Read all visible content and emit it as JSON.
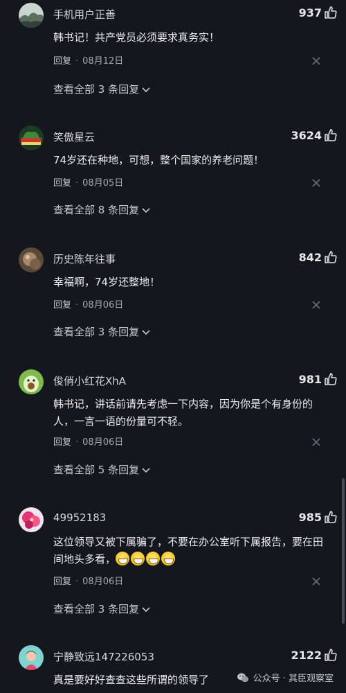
{
  "meta_labels": {
    "reply": "回复",
    "dot": "·"
  },
  "comments": [
    {
      "username": "手机用户正善",
      "likes": "937",
      "content": "韩书记！共产党员必须要求真务实！",
      "date": "08月12日",
      "view_replies": "查看全部 3 条回复"
    },
    {
      "username": "笑傲星云",
      "likes": "3624",
      "content": "74岁还在种地，可想，整个国家的养老问题！",
      "date": "08月05日",
      "view_replies": "查看全部 8 条回复"
    },
    {
      "username": "历史陈年往事",
      "likes": "842",
      "content": "幸福啊，74岁还整地！",
      "date": "08月06日",
      "view_replies": "查看全部 3 条回复"
    },
    {
      "username": "俊俏小红花XhA",
      "likes": "981",
      "content": "韩书记，讲话前请先考虑一下内容，因为你是个有身份的人，一言一语的份量可不轻。",
      "date": "08月06日",
      "view_replies": "查看全部 5 条回复"
    },
    {
      "username": "49952183",
      "likes": "985",
      "content": "这位领导又被下属骗了，不要在办公室听下属报告，要在田间地头多看，",
      "date": "08月06日",
      "view_replies": "查看全部 3 条回复"
    },
    {
      "username": "宁静致远147226053",
      "likes": "2122",
      "content": "真是要好好查查这些所谓的领导了"
    }
  ],
  "watermark": {
    "text": "公众号 · 其臣观察室"
  },
  "icons": {
    "like": "thumbs-up-icon",
    "close": "close-icon",
    "chevron": "chevron-down-icon"
  },
  "colors": {
    "background": "#16161e",
    "text": "#ededf0",
    "muted": "#a8a8b0"
  }
}
